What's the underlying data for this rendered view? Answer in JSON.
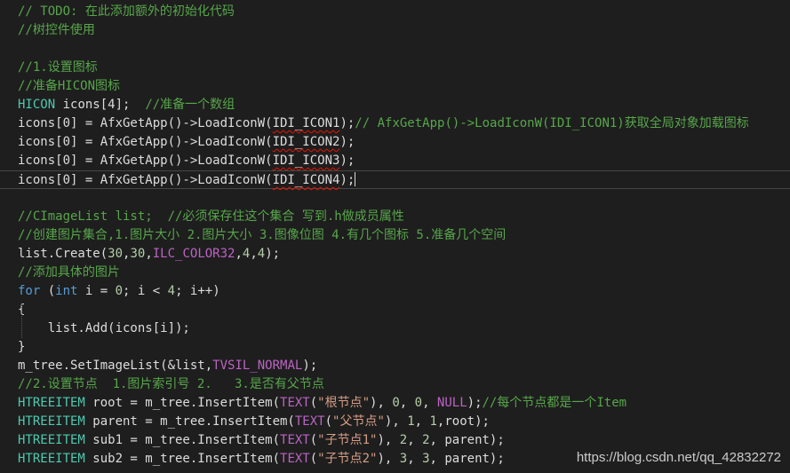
{
  "editor": {
    "lines": [
      {
        "current": false,
        "tokens": [
          {
            "t": "// TODO: 在此添加额外的初始化代码",
            "c": "c"
          }
        ]
      },
      {
        "current": false,
        "tokens": [
          {
            "t": "//树控件使用",
            "c": "c"
          }
        ]
      },
      {
        "current": false,
        "tokens": []
      },
      {
        "current": false,
        "tokens": [
          {
            "t": "//1.设置图标",
            "c": "c"
          }
        ]
      },
      {
        "current": false,
        "tokens": [
          {
            "t": "//准备HICON图标",
            "c": "c"
          }
        ]
      },
      {
        "current": false,
        "tokens": [
          {
            "t": "HICON",
            "c": "t"
          },
          {
            "t": " icons[4];  ",
            "c": "p"
          },
          {
            "t": "//准备一个数组",
            "c": "c"
          }
        ]
      },
      {
        "current": false,
        "tokens": [
          {
            "t": "icons[0] = AfxGetApp()->LoadIconW(",
            "c": "p"
          },
          {
            "t": "IDI_ICON1",
            "c": "sq"
          },
          {
            "t": ");",
            "c": "p"
          },
          {
            "t": "// AfxGetApp()->LoadIconW(IDI_ICON1)获取全局对象加载图标",
            "c": "c"
          }
        ]
      },
      {
        "current": false,
        "tokens": [
          {
            "t": "icons[0] = AfxGetApp()->LoadIconW(",
            "c": "p"
          },
          {
            "t": "IDI_ICON2",
            "c": "sq"
          },
          {
            "t": ");",
            "c": "p"
          }
        ]
      },
      {
        "current": false,
        "tokens": [
          {
            "t": "icons[0] = AfxGetApp()->LoadIconW(",
            "c": "p"
          },
          {
            "t": "IDI_ICON3",
            "c": "sq"
          },
          {
            "t": ");",
            "c": "p"
          }
        ]
      },
      {
        "current": true,
        "tokens": [
          {
            "t": "icons[0] = AfxGetApp()->LoadIconW(",
            "c": "p"
          },
          {
            "t": "IDI_ICON4",
            "c": "sq"
          },
          {
            "t": ");",
            "c": "p"
          }
        ]
      },
      {
        "current": false,
        "tokens": []
      },
      {
        "current": false,
        "tokens": [
          {
            "t": "//CImageList list;  //必须保存住这个集合 写到.h做成员属性",
            "c": "c"
          }
        ]
      },
      {
        "current": false,
        "tokens": [
          {
            "t": "//创建图片集合,1.图片大小 2.图片大小 3.图像位图 4.有几个图标 5.准备几个空间",
            "c": "c"
          }
        ]
      },
      {
        "current": false,
        "tokens": [
          {
            "t": "list.Create(",
            "c": "p"
          },
          {
            "t": "30",
            "c": "n"
          },
          {
            "t": ",",
            "c": "p"
          },
          {
            "t": "30",
            "c": "n"
          },
          {
            "t": ",",
            "c": "p"
          },
          {
            "t": "ILC_COLOR32",
            "c": "m"
          },
          {
            "t": ",",
            "c": "p"
          },
          {
            "t": "4",
            "c": "n"
          },
          {
            "t": ",",
            "c": "p"
          },
          {
            "t": "4",
            "c": "n"
          },
          {
            "t": ");",
            "c": "p"
          }
        ]
      },
      {
        "current": false,
        "tokens": [
          {
            "t": "//添加具体的图片",
            "c": "c"
          }
        ]
      },
      {
        "current": false,
        "tokens": [
          {
            "t": "for",
            "c": "k"
          },
          {
            "t": " (",
            "c": "p"
          },
          {
            "t": "int",
            "c": "k"
          },
          {
            "t": " i = ",
            "c": "p"
          },
          {
            "t": "0",
            "c": "n"
          },
          {
            "t": "; i < ",
            "c": "p"
          },
          {
            "t": "4",
            "c": "n"
          },
          {
            "t": "; i++)",
            "c": "p"
          }
        ]
      },
      {
        "current": false,
        "tokens": [
          {
            "t": "{",
            "c": "p"
          }
        ]
      },
      {
        "current": false,
        "tokens": [
          {
            "t": "    list.Add(icons[i]);",
            "c": "p"
          }
        ]
      },
      {
        "current": false,
        "tokens": [
          {
            "t": "}",
            "c": "p"
          }
        ]
      },
      {
        "current": false,
        "tokens": [
          {
            "t": "m_tree.SetImageList(&list,",
            "c": "p"
          },
          {
            "t": "TVSIL_NORMAL",
            "c": "m"
          },
          {
            "t": ");",
            "c": "p"
          }
        ]
      },
      {
        "current": false,
        "tokens": [
          {
            "t": "//2.设置节点  1.图片索引号 2.   3.是否有父节点",
            "c": "c"
          }
        ]
      },
      {
        "current": false,
        "tokens": [
          {
            "t": "HTREEITEM",
            "c": "t"
          },
          {
            "t": " root = m_tree.InsertItem(",
            "c": "p"
          },
          {
            "t": "TEXT",
            "c": "m"
          },
          {
            "t": "(",
            "c": "p"
          },
          {
            "t": "\"根节点\"",
            "c": "s"
          },
          {
            "t": "), ",
            "c": "p"
          },
          {
            "t": "0",
            "c": "n"
          },
          {
            "t": ", ",
            "c": "p"
          },
          {
            "t": "0",
            "c": "n"
          },
          {
            "t": ", ",
            "c": "p"
          },
          {
            "t": "NULL",
            "c": "m"
          },
          {
            "t": ");",
            "c": "p"
          },
          {
            "t": "//每个节点都是一个Item",
            "c": "c"
          }
        ]
      },
      {
        "current": false,
        "tokens": [
          {
            "t": "HTREEITEM",
            "c": "t"
          },
          {
            "t": " parent = m_tree.InsertItem(",
            "c": "p"
          },
          {
            "t": "TEXT",
            "c": "m"
          },
          {
            "t": "(",
            "c": "p"
          },
          {
            "t": "\"父节点\"",
            "c": "s"
          },
          {
            "t": "), ",
            "c": "p"
          },
          {
            "t": "1",
            "c": "n"
          },
          {
            "t": ", ",
            "c": "p"
          },
          {
            "t": "1",
            "c": "n"
          },
          {
            "t": ",root);",
            "c": "p"
          }
        ]
      },
      {
        "current": false,
        "tokens": [
          {
            "t": "HTREEITEM",
            "c": "t"
          },
          {
            "t": " sub1 = m_tree.InsertItem(",
            "c": "p"
          },
          {
            "t": "TEXT",
            "c": "m"
          },
          {
            "t": "(",
            "c": "p"
          },
          {
            "t": "\"子节点1\"",
            "c": "s"
          },
          {
            "t": "), ",
            "c": "p"
          },
          {
            "t": "2",
            "c": "n"
          },
          {
            "t": ", ",
            "c": "p"
          },
          {
            "t": "2",
            "c": "n"
          },
          {
            "t": ", parent);",
            "c": "p"
          }
        ]
      },
      {
        "current": false,
        "tokens": [
          {
            "t": "HTREEITEM",
            "c": "t"
          },
          {
            "t": " sub2 = m_tree.InsertItem(",
            "c": "p"
          },
          {
            "t": "TEXT",
            "c": "m"
          },
          {
            "t": "(",
            "c": "p"
          },
          {
            "t": "\"子节点2\"",
            "c": "s"
          },
          {
            "t": "), ",
            "c": "p"
          },
          {
            "t": "3",
            "c": "n"
          },
          {
            "t": ", ",
            "c": "p"
          },
          {
            "t": "3",
            "c": "n"
          },
          {
            "t": ", parent);",
            "c": "p"
          }
        ]
      }
    ]
  },
  "watermark": {
    "text": "https://blog.csdn.net/qq_42832272"
  },
  "colors": {
    "background": "#1e1e1e",
    "comment": "#57a64a",
    "type": "#4ec9b0",
    "keyword": "#569cd6",
    "macro": "#bd63c5",
    "string": "#d69d85",
    "number": "#b5cea8",
    "plain": "#dcdcdc",
    "error_squiggle": "#e51400"
  }
}
